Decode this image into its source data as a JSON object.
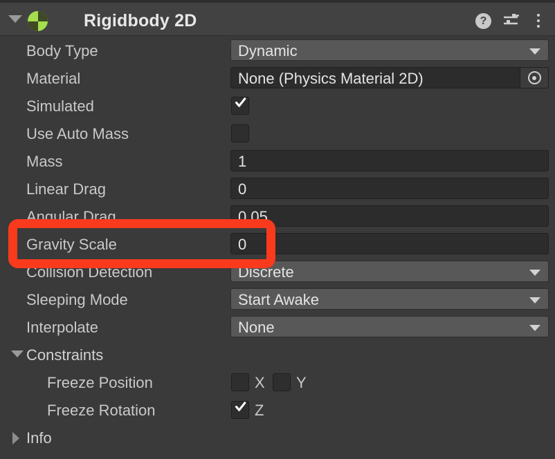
{
  "component": {
    "title": "Rigidbody 2D",
    "icon": "rigidbody2d-icon",
    "foldout_icon": "chevron-down-icon",
    "accent_green": "#a5de4e",
    "header_buttons": [
      {
        "name": "help-icon",
        "glyph": "?"
      },
      {
        "name": "preset-icon",
        "glyph": ""
      },
      {
        "name": "more-menu-icon",
        "glyph": ""
      }
    ]
  },
  "properties": [
    {
      "label": "Body Type",
      "type": "enum",
      "value": "Dynamic"
    },
    {
      "label": "Material",
      "type": "object",
      "value": "None (Physics Material 2D)"
    },
    {
      "label": "Simulated",
      "type": "checkbox",
      "value": true
    },
    {
      "label": "Use Auto Mass",
      "type": "checkbox",
      "value": false
    },
    {
      "label": "Mass",
      "type": "number",
      "value": "1"
    },
    {
      "label": "Linear Drag",
      "type": "number",
      "value": "0"
    },
    {
      "label": "Angular Drag",
      "type": "number",
      "value": "0.05"
    },
    {
      "label": "Gravity Scale",
      "type": "number",
      "value": "0"
    },
    {
      "label": "Collision Detection",
      "type": "enum",
      "value": "Discrete"
    },
    {
      "label": "Sleeping Mode",
      "type": "enum",
      "value": "Start Awake"
    },
    {
      "label": "Interpolate",
      "type": "enum",
      "value": "None"
    }
  ],
  "constraints": {
    "label": "Constraints",
    "expanded": true,
    "freeze_position": {
      "label": "Freeze Position",
      "axes": [
        {
          "axis": "X",
          "checked": false
        },
        {
          "axis": "Y",
          "checked": false
        }
      ]
    },
    "freeze_rotation": {
      "label": "Freeze Rotation",
      "axes": [
        {
          "axis": "Z",
          "checked": true
        }
      ]
    }
  },
  "info": {
    "label": "Info",
    "expanded": false
  },
  "annotation": {
    "name": "gravity-scale-highlight",
    "color": "#f93a1d",
    "targets": "Gravity Scale"
  }
}
